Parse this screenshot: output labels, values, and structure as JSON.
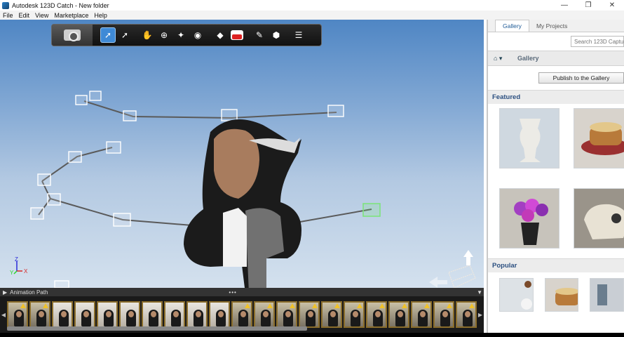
{
  "window": {
    "title": "Autodesk 123D Catch - New folder",
    "controls": [
      "—",
      "❐",
      "✕"
    ]
  },
  "menu": [
    "File",
    "Edit",
    "View",
    "Marketplace",
    "Help"
  ],
  "toolbar": {
    "tools": [
      "select-icon",
      "orbit-icon",
      "pan-icon",
      "zoom-icon",
      "fly-icon",
      "capture-icon",
      "bookmark-icon",
      "youtube-icon",
      "pen-icon",
      "mesh-icon",
      "properties-icon"
    ]
  },
  "axes": {
    "x": "X",
    "y": "Y",
    "z": "Z"
  },
  "filmstrip": {
    "label": "Animation Path",
    "dots": "•••",
    "frame_count": 21
  },
  "right_panel": {
    "tabs": [
      "Gallery",
      "My Projects"
    ],
    "active_tab": "Gallery",
    "search_placeholder": "Search 123D Captu",
    "breadcrumb": "Gallery",
    "publish_label": "Publish to the Gallery",
    "featured_title": "Featured",
    "popular_title": "Popular"
  },
  "colors": {
    "accent": "#2b4f80",
    "toolbar_active": "#3f8ad6"
  }
}
